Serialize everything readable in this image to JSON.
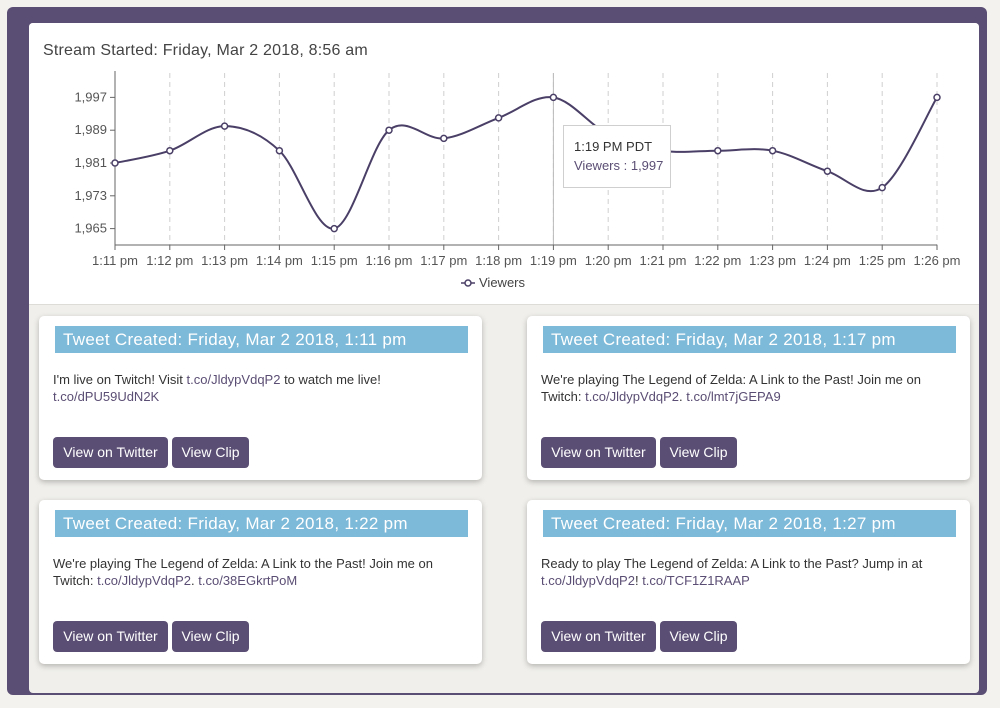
{
  "stream": {
    "title": "Stream Started: Friday, Mar 2 2018, 8:56 am"
  },
  "chart_data": {
    "type": "line",
    "categories": [
      "1:11 pm",
      "1:12 pm",
      "1:13 pm",
      "1:14 pm",
      "1:15 pm",
      "1:16 pm",
      "1:17 pm",
      "1:18 pm",
      "1:19 pm",
      "1:20 pm",
      "1:21 pm",
      "1:22 pm",
      "1:23 pm",
      "1:24 pm",
      "1:25 pm",
      "1:26 pm"
    ],
    "series": [
      {
        "name": "Viewers",
        "values": [
          1981,
          1984,
          1990,
          1984,
          1965,
          1989,
          1987,
          1992,
          1997,
          1988,
          1984,
          1984,
          1984,
          1979,
          1975,
          1997
        ],
        "color": "#4a3f66"
      }
    ],
    "yticks": [
      1965,
      1973,
      1981,
      1989,
      1997
    ],
    "yticklabels": [
      "1,965",
      "1,973",
      "1,981",
      "1,989",
      "1,997"
    ],
    "ylim": [
      1961,
      2001
    ],
    "grid": "vertical-dashed",
    "legend_position": "bottom-center"
  },
  "tooltip": {
    "time": "1:19 PM PDT",
    "value": "Viewers : 1,997"
  },
  "legend": {
    "label": "Viewers"
  },
  "tweets": [
    {
      "header": "Tweet Created: Friday, Mar 2 2018, 1:11 pm",
      "line1_text": "I'm live on Twitch! Visit ",
      "line1_link": "t.co/JldypVdqP2",
      "line1_tail": " to watch me live!",
      "line2_link1": "t.co/dPU59UdN2K",
      "line2_sep": "",
      "line2_link2": "",
      "btn_twitter": "View on Twitter",
      "btn_clip": "View Clip"
    },
    {
      "header": "Tweet Created: Friday, Mar 2 2018, 1:17 pm",
      "line1_text": "We're playing The Legend of Zelda: A Link to the Past! Join me on",
      "line1_link": "",
      "line1_tail": "",
      "line2_prefix": "Twitch: ",
      "line2_link1": "t.co/JldypVdqP2",
      "line2_sep": ". ",
      "line2_link2": "t.co/lmt7jGEPA9",
      "btn_twitter": "View on Twitter",
      "btn_clip": "View Clip"
    },
    {
      "header": "Tweet Created: Friday, Mar 2 2018, 1:22 pm",
      "line1_text": "We're playing The Legend of Zelda: A Link to the Past! Join me on",
      "line1_link": "",
      "line1_tail": "",
      "line2_prefix": "Twitch: ",
      "line2_link1": "t.co/JldypVdqP2",
      "line2_sep": ". ",
      "line2_link2": "t.co/38EGkrtPoM",
      "btn_twitter": "View on Twitter",
      "btn_clip": "View Clip"
    },
    {
      "header": "Tweet Created: Friday, Mar 2 2018, 1:27 pm",
      "line1_text": "Ready to play The Legend of Zelda: A Link to the Past? Jump in at",
      "line1_link": "",
      "line1_tail": "",
      "line2_prefix": "",
      "line2_link1": "t.co/JldypVdqP2",
      "line2_sep": "! ",
      "line2_link2": "t.co/TCF1Z1RAAP",
      "btn_twitter": "View on Twitter",
      "btn_clip": "View Clip"
    }
  ],
  "colors": {
    "frame": "#5b4e74",
    "accent": "#7db9d8",
    "button": "#5b4e74",
    "line": "#4a3f66"
  }
}
